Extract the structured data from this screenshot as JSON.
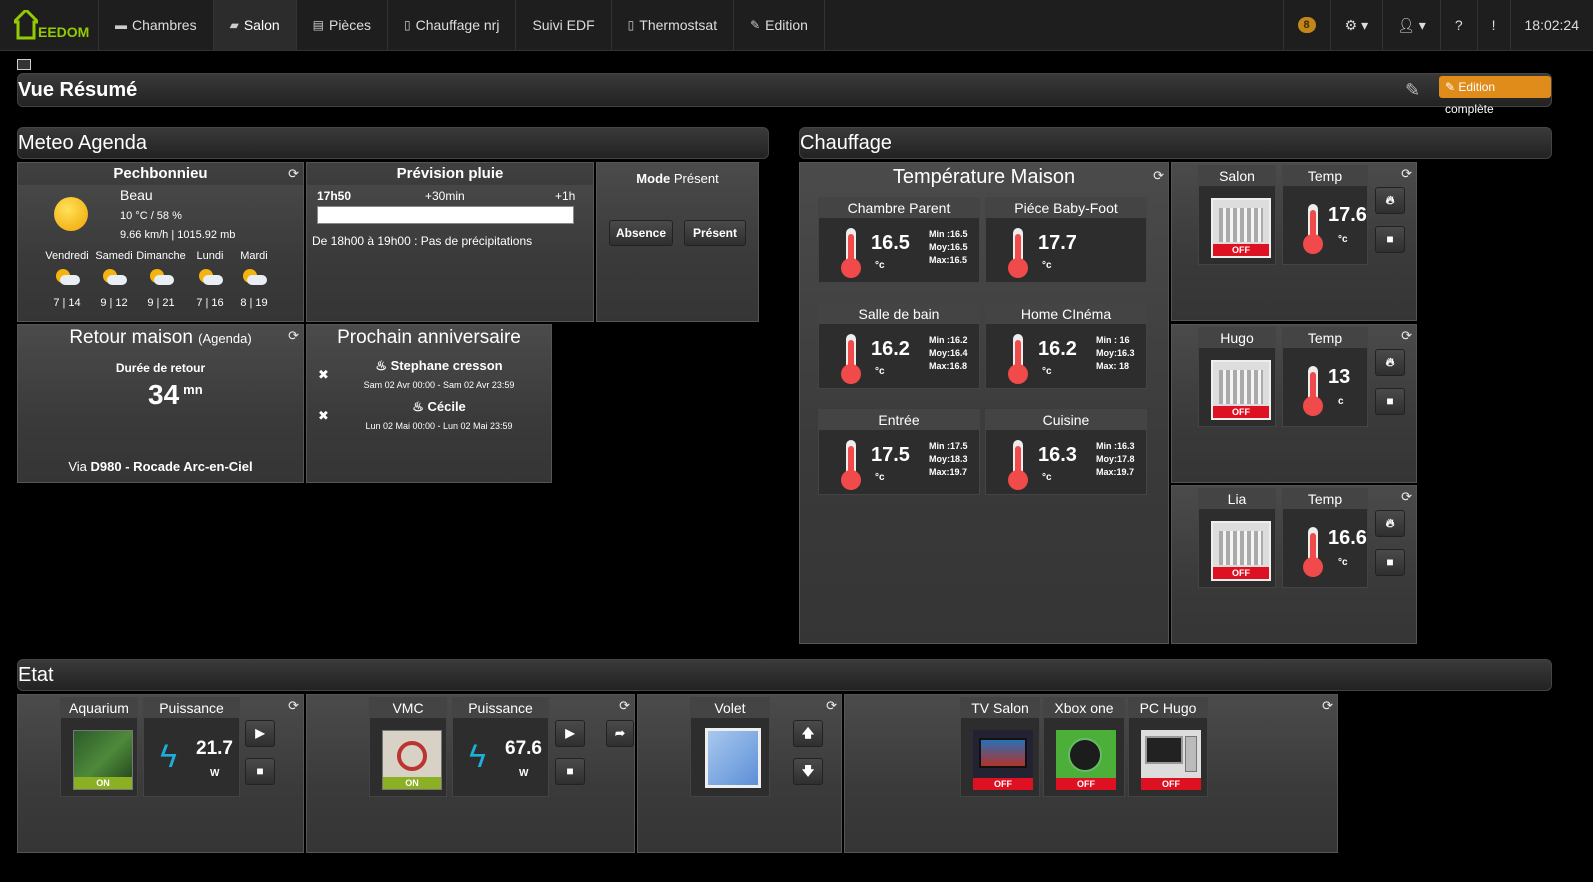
{
  "nav": {
    "brand": "EEDOM",
    "items": [
      {
        "label": "Chambres",
        "icon": "bed-icon"
      },
      {
        "label": "Salon",
        "icon": "sofa-icon"
      },
      {
        "label": "Pièces",
        "icon": "rooms-icon"
      },
      {
        "label": "Chauffage nrj",
        "icon": "heating-icon"
      },
      {
        "label": "Suivi EDF",
        "icon": ""
      },
      {
        "label": "Thermostsat",
        "icon": "thermostat-icon"
      },
      {
        "label": "Edition",
        "icon": "pencil-icon"
      }
    ],
    "badge": "8",
    "time": "18:02:24"
  },
  "summary": {
    "title": "Vue Résumé",
    "edit_button": "Edition complète"
  },
  "meteo_section": {
    "title": "Meteo Agenda"
  },
  "chauffage_section": {
    "title": "Chauffage"
  },
  "etat_section": {
    "title": "Etat"
  },
  "weather": {
    "city": "Pechbonnieu",
    "condition": "Beau",
    "temp_humidity": "10 °C / 58 %",
    "wind_pressure": "9.66 km/h | 1015.92 mb",
    "forecast": [
      {
        "day": "Vendredi",
        "temps": "7 | 14"
      },
      {
        "day": "Samedi",
        "temps": "9 | 12"
      },
      {
        "day": "Dimanche",
        "temps": "9 | 21"
      },
      {
        "day": "Lundi",
        "temps": "7 | 16"
      },
      {
        "day": "Mardi",
        "temps": "8 | 19"
      }
    ]
  },
  "rain": {
    "title": "Prévision pluie",
    "t0": "17h50",
    "t1": "+30min",
    "t2": "+1h",
    "text": "De 18h00 à 19h00 : Pas de précipitations"
  },
  "mode": {
    "label": "Mode",
    "value": "Présent",
    "btn_absence": "Absence",
    "btn_present": "Présent"
  },
  "retour": {
    "title": "Retour maison",
    "subtitle": "(Agenda)",
    "duration_label": "Durée de retour",
    "duration": "34",
    "unit": "mn",
    "via": "Via",
    "route": "D980 - Rocade Arc-en-Ciel"
  },
  "birthday": {
    "title": "Prochain anniversaire",
    "items": [
      {
        "name": "Stephane cresson",
        "date": "Sam 02 Avr 00:00 - Sam 02 Avr 23:59"
      },
      {
        "name": "Cécile",
        "date": "Lun 02 Mai 00:00 - Lun 02 Mai 23:59"
      }
    ]
  },
  "temp_maison": {
    "title": "Température Maison",
    "rooms": [
      {
        "name": "Chambre Parent",
        "value": "16.5",
        "min": "Min :16.5",
        "moy": "Moy:16.5",
        "max": "Max:16.5"
      },
      {
        "name": "Piéce Baby-Foot",
        "value": "17.7",
        "min": "",
        "moy": "",
        "max": ""
      },
      {
        "name": "Salle de bain",
        "value": "16.2",
        "min": "Min :16.2",
        "moy": "Moy:16.4",
        "max": "Max:16.8"
      },
      {
        "name": "Home CInéma",
        "value": "16.2",
        "min": "Min :   16",
        "moy": "Moy:16.3",
        "max": "Max:    18"
      },
      {
        "name": "Entrée",
        "value": "17.5",
        "min": "Min :17.5",
        "moy": "Moy:18.3",
        "max": "Max:19.7"
      },
      {
        "name": "Cuisine",
        "value": "16.3",
        "min": "Min :16.3",
        "moy": "Moy:17.8",
        "max": "Max:19.7"
      }
    ],
    "unit": "°c"
  },
  "heaters": [
    {
      "name": "Salon",
      "state": "OFF",
      "temp_label": "Temp",
      "temp": "17.6",
      "unit": "°c"
    },
    {
      "name": "Hugo",
      "state": "OFF",
      "temp_label": "Temp",
      "temp": "13",
      "unit": "c"
    },
    {
      "name": "Lia",
      "state": "OFF",
      "temp_label": "Temp",
      "temp": "16.6",
      "unit": "°c"
    }
  ],
  "etat": {
    "aquarium": {
      "name": "Aquarium",
      "state": "ON",
      "power_label": "Puissance",
      "power": "21.7",
      "unit": "W"
    },
    "vmc": {
      "name": "VMC",
      "state": "ON",
      "power_label": "Puissance",
      "power": "67.6",
      "unit": "W"
    },
    "volet": {
      "name": "Volet"
    },
    "devices": [
      {
        "name": "TV Salon",
        "state": "OFF"
      },
      {
        "name": "Xbox one",
        "state": "OFF"
      },
      {
        "name": "PC Hugo",
        "state": "OFF"
      }
    ]
  }
}
